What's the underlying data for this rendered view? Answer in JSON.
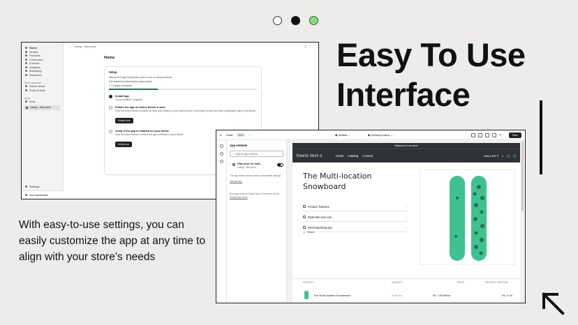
{
  "headline": {
    "line1": "Easy To Use",
    "line2": "Interface"
  },
  "description": "With easy-to-use settings, you can easily customize the app at any time to align with your store’s needs",
  "admin": {
    "nav": [
      "Home",
      "Orders",
      "Products",
      "Customers",
      "Content",
      "Analytics",
      "Marketing",
      "Discounts"
    ],
    "sales_channels_label": "Sales channels",
    "channels": [
      "Online Store",
      "Point of Sale"
    ],
    "apps_label": "Apps",
    "apps": [
      "Flow"
    ],
    "app_item": "Listing - Hide price",
    "settings": "Settings",
    "non_transferable": "Non-transferable",
    "breadcrumb": "Listing - Hide price",
    "page_title": "Home",
    "setup": {
      "title": "Setup",
      "welcome": "Welcome to app Easily hide price on out of stock products",
      "subtitle": "Get started by following the steps below.",
      "progress_text": "1 / 3 steps completed",
      "progress": 0.33,
      "steps": [
        {
          "title": "Install App",
          "desc": "You've installed, Congrats!",
          "done": true,
          "button": ""
        },
        {
          "title": "Enable the app on active theme & save",
          "desc": "Click the button below to enable the Hide price feature on your active theme. Dont forget to click save after enabling the app on the theme.",
          "done": false,
          "button": "Enable now"
        },
        {
          "title": "Verify if the app is enabled on your theme",
          "desc": "Click the button below to verify if the app is enabled on your theme.",
          "done": false,
          "button": "Verify now"
        }
      ]
    }
  },
  "editor": {
    "store_name": "Trade",
    "status": "Live",
    "theme": "Default",
    "template": "Default product",
    "save": "Save",
    "panel_title": "App embeds",
    "search_placeholder": "Search app embeds",
    "embed_title": "Hide price on sold...",
    "embed_sub": "Listing - Hide price",
    "embed_note": "This app embed doesn't have customizable settings.",
    "manage_app": "Manage app",
    "footer_note_1": "Rest apps built for Online Store 2.0 themes on the ",
    "footer_link": "Shopify App Store",
    "store": {
      "announcement": "Welcome to our store",
      "logo": "heels-test-s",
      "nav": [
        "Home",
        "Catalog",
        "Contact"
      ],
      "locale": "India | INR ₹",
      "product_title_1": "The Multi-location",
      "product_title_2": "Snowboard",
      "accordions": [
        "Product features",
        "Materials and care",
        "Merchandising tips"
      ],
      "share": "Share",
      "table_headers": [
        "PRODUCT",
        "QUANTITY",
        "PRICE",
        "PRODUCT SUBTOTAL"
      ],
      "row": {
        "name": "The Multi-location Snowboard",
        "qty": "Sold out",
        "price": "Rs. 729.95/ea",
        "subtotal": "Rs. 0.00"
      }
    }
  },
  "colors": {
    "accent_green": "#7fe07a",
    "dark": "#111111",
    "board_green": "#3ec28f"
  }
}
